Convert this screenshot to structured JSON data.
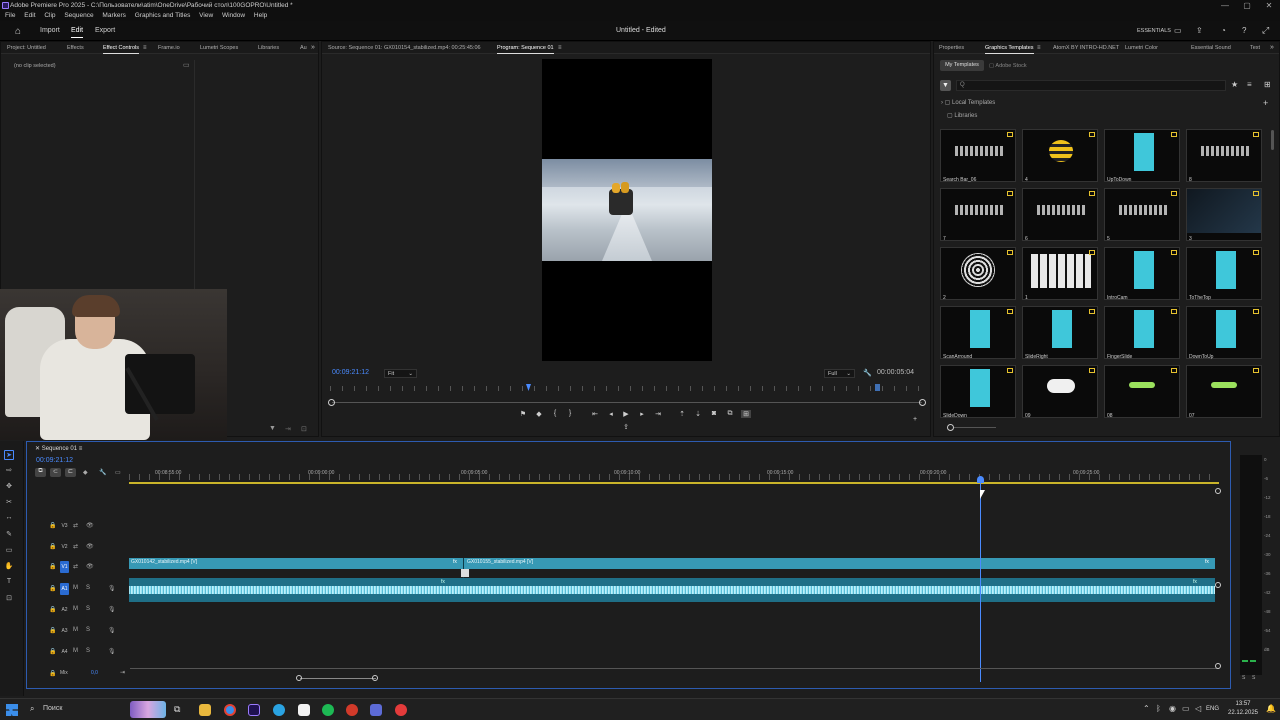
{
  "titlebar": {
    "text": "Adobe Premiere Pro 2025 - C:\\Пользователи\\atim\\OneDrive\\Рабочий стол\\100GOPRO\\Untitled *"
  },
  "menubar": {
    "items": [
      "File",
      "Edit",
      "Clip",
      "Sequence",
      "Markers",
      "Graphics and Titles",
      "View",
      "Window",
      "Help"
    ]
  },
  "workspace": {
    "tabs": [
      "Import",
      "Edit",
      "Export"
    ],
    "active": "Edit",
    "doc_title": "Untitled - Edited",
    "essentials": "ESSENTIALS"
  },
  "left_panel": {
    "tabs": [
      "Project: Untitled",
      "Effects",
      "Effect Controls",
      "Frame.io",
      "Lumetri Scopes",
      "Libraries",
      "Au"
    ],
    "active": "Effect Controls",
    "empty_text": "(no clip selected)"
  },
  "monitor": {
    "source_tab": "Source: Sequence 01: GX010154_stabilized.mp4: 00:25:45:06",
    "program_tab": "Program: Sequence 01",
    "timecode": "00:09:21:12",
    "fit": "Fit",
    "quality": "Full",
    "duration": "00:00:05:04"
  },
  "graphics": {
    "tabs": [
      "Properties",
      "Graphics Templates",
      "AtomX BY INTRO-HD.NET",
      "Lumetri Color",
      "Essential Sound",
      "Text"
    ],
    "active": "Graphics Templates",
    "subtabs": [
      "My Templates",
      "Adobe Stock"
    ],
    "search_placeholder": "Q",
    "tree": [
      "Local Templates",
      "Libraries"
    ],
    "templates": [
      {
        "name": "Search Bar_06",
        "art": "SEARCH"
      },
      {
        "name": "4",
        "art": "BEE"
      },
      {
        "name": "UpToDown",
        "art": "CYAN"
      },
      {
        "name": "8",
        "art": "STRENGTH"
      },
      {
        "name": "7",
        "art": "BOLD"
      },
      {
        "name": "6",
        "art": "TEXT"
      },
      {
        "name": "5",
        "art": "CONTROL FEELINGS BETTER"
      },
      {
        "name": "3",
        "art": "DARK"
      },
      {
        "name": "2",
        "art": "MODERN"
      },
      {
        "name": "1",
        "art": "MOSION"
      },
      {
        "name": "IntroCam",
        "art": "CYAN"
      },
      {
        "name": "ToTheTop",
        "art": "CYAN"
      },
      {
        "name": "ScanArround",
        "art": "CYAN"
      },
      {
        "name": "SlideRight",
        "art": "CYAN"
      },
      {
        "name": "FingerSlide",
        "art": "CYAN"
      },
      {
        "name": "DownToUp",
        "art": "CYAN"
      },
      {
        "name": "SlideDown",
        "art": "CYAN"
      },
      {
        "name": "09",
        "art": "BUBBLE"
      },
      {
        "name": "08",
        "art": "GREEN"
      },
      {
        "name": "07",
        "art": "GREEN"
      }
    ]
  },
  "timeline": {
    "sequence_tab": "Sequence 01",
    "timecode": "00:09:21:12",
    "ruler": [
      "00:08:55:00",
      "00:09:00:00",
      "00:09:05:00",
      "00:09:10:00",
      "00:09:15:00",
      "00:09:20:00",
      "00:09:25:00"
    ],
    "video_tracks": [
      "V3",
      "V2",
      "V1"
    ],
    "audio_tracks": [
      "A1",
      "A2",
      "A3",
      "A4"
    ],
    "mix_label": "Mix",
    "mix_value": "0,0",
    "clips": [
      "GX010142_stabilized.mp4 [V]",
      "GX010155_stabilized.mp4 [V]"
    ],
    "meter_scale": [
      "0",
      "-6",
      "-12",
      "-18",
      "-24",
      "-30",
      "-36",
      "-42",
      "-48",
      "-54",
      "dB"
    ],
    "meter_foot": [
      "S",
      "S"
    ]
  },
  "taskbar": {
    "search": "Поиск",
    "lang": "ENG",
    "time": "13:57",
    "date": "22.12.2025"
  }
}
